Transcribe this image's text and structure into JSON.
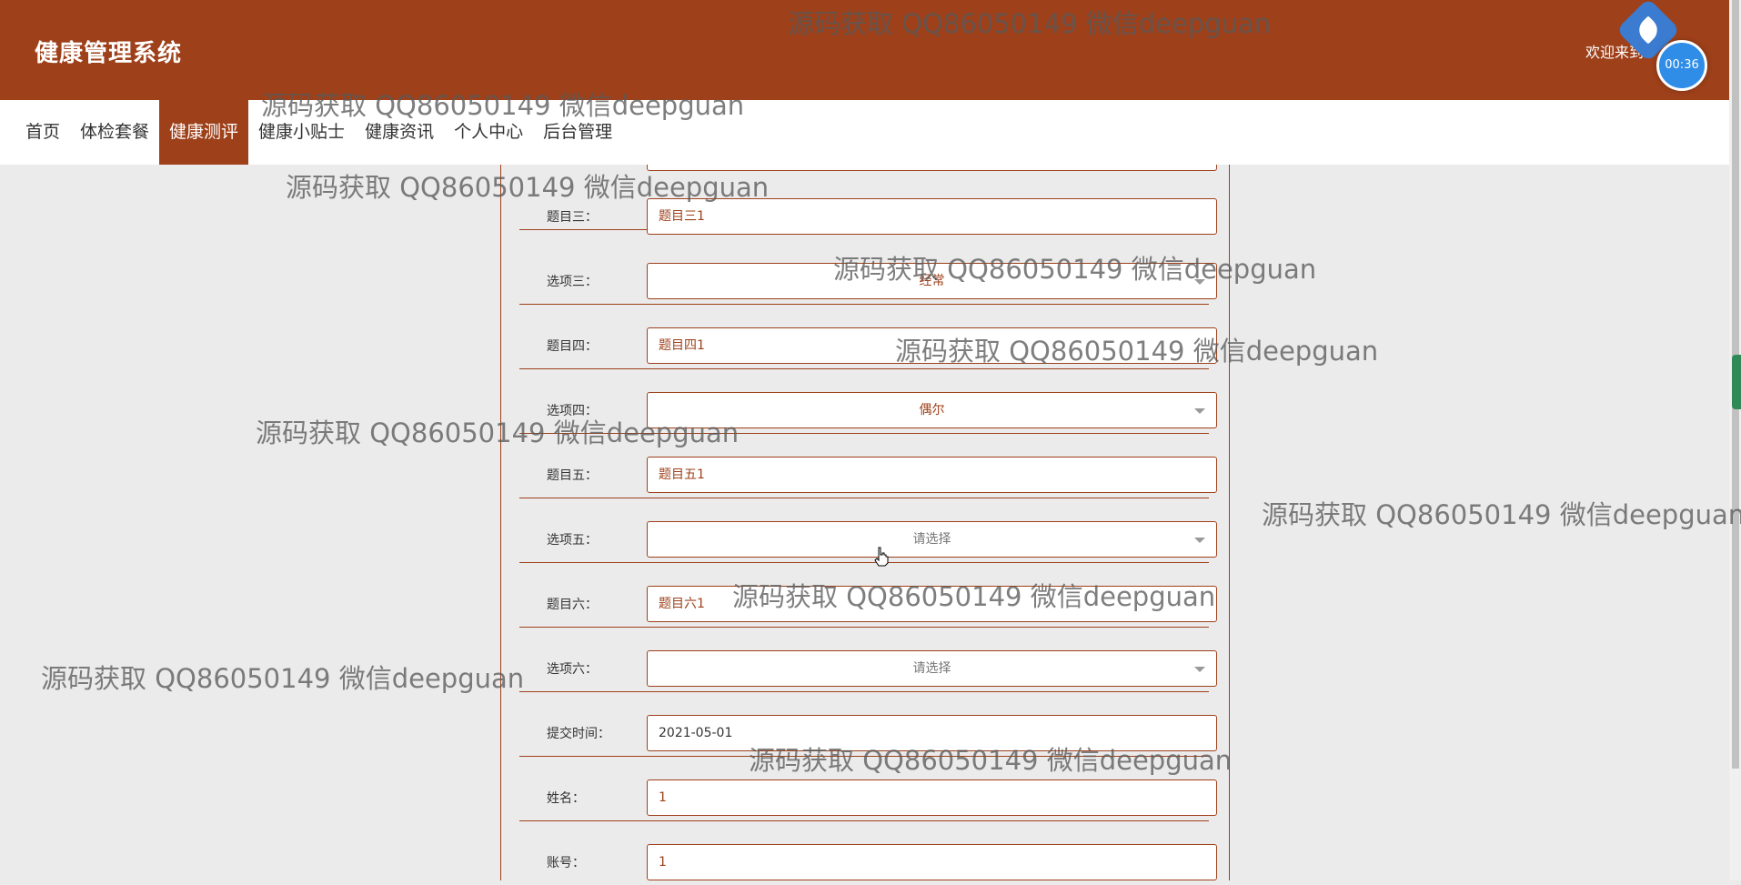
{
  "header": {
    "title": "健康管理系统",
    "welcome": "欢迎来到",
    "timer": "00:36"
  },
  "nav": {
    "items": [
      "首页",
      "体检套餐",
      "健康测评",
      "健康小贴士",
      "健康资讯",
      "个人中心",
      "后台管理"
    ],
    "active": "健康测评"
  },
  "form": {
    "rows": [
      {
        "label": "题目三：",
        "type": "text",
        "value": "题目三1"
      },
      {
        "label": "选项三：",
        "type": "select",
        "value": "经常"
      },
      {
        "label": "题目四：",
        "type": "text",
        "value": "题目四1"
      },
      {
        "label": "选项四：",
        "type": "select",
        "value": "偶尔"
      },
      {
        "label": "题目五：",
        "type": "text",
        "value": "题目五1"
      },
      {
        "label": "选项五：",
        "type": "select",
        "value": "请选择"
      },
      {
        "label": "题目六：",
        "type": "text",
        "value": "题目六1"
      },
      {
        "label": "选项六：",
        "type": "select",
        "value": "请选择"
      },
      {
        "label": "提交时间：",
        "type": "date",
        "value": "2021-05-01"
      },
      {
        "label": "姓名：",
        "type": "text",
        "value": "1"
      },
      {
        "label": "账号：",
        "type": "text",
        "value": "1"
      }
    ]
  },
  "watermark": {
    "text": "源码获取 QQ86050149 微信deepguan"
  }
}
